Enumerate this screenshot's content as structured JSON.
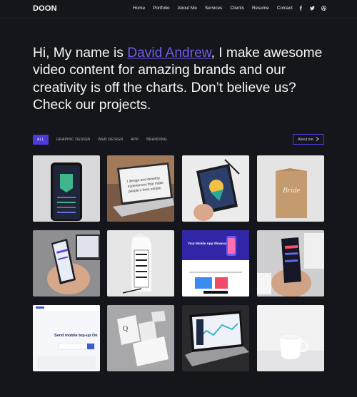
{
  "header": {
    "logo": "DOON",
    "nav": [
      "Home",
      "Portfolio",
      "About Me",
      "Services",
      "Clients",
      "Resume",
      "Contact"
    ],
    "social_icons": [
      "facebook-icon",
      "twitter-icon",
      "dribbble-icon"
    ]
  },
  "hero": {
    "prefix": "Hi, My name is ",
    "name": "David Andrew",
    "suffix": ", I make awesome video content for amazing brands and our creativity is off the charts. Don’t believe us? Check our projects."
  },
  "filters": [
    "ALL",
    "GRAPHIC DESIGN",
    "WEB DESIGN",
    "APP",
    "BRANDING"
  ],
  "about_button": {
    "label": "About me",
    "icon": "chevron-right-icon"
  },
  "portfolio": {
    "tiles": [
      {
        "name": "phone-app-dark",
        "alt": "phone app mockup"
      },
      {
        "name": "laptop-design-text",
        "line1": "I design and develop",
        "line2": "experiences that make",
        "line3": "people's lives simple."
      },
      {
        "name": "tablet-illustration",
        "alt": "tablet illustration"
      },
      {
        "name": "bride-card",
        "text": "Bride"
      },
      {
        "name": "phone-in-hand",
        "alt": "phone in hand"
      },
      {
        "name": "milk-carton",
        "alt": "milk carton branding"
      },
      {
        "name": "mobile-app-showcase",
        "text": "Your Mobile App Showcase"
      },
      {
        "name": "phone-app-dark-hand",
        "alt": "phone app in hand"
      },
      {
        "name": "website-topup",
        "text": "Send mobile top-up On"
      },
      {
        "name": "stationery",
        "alt": "stationery mockup"
      },
      {
        "name": "laptop-dashboard",
        "alt": "laptop dashboard"
      },
      {
        "name": "white-mug",
        "alt": "white mug"
      }
    ]
  }
}
